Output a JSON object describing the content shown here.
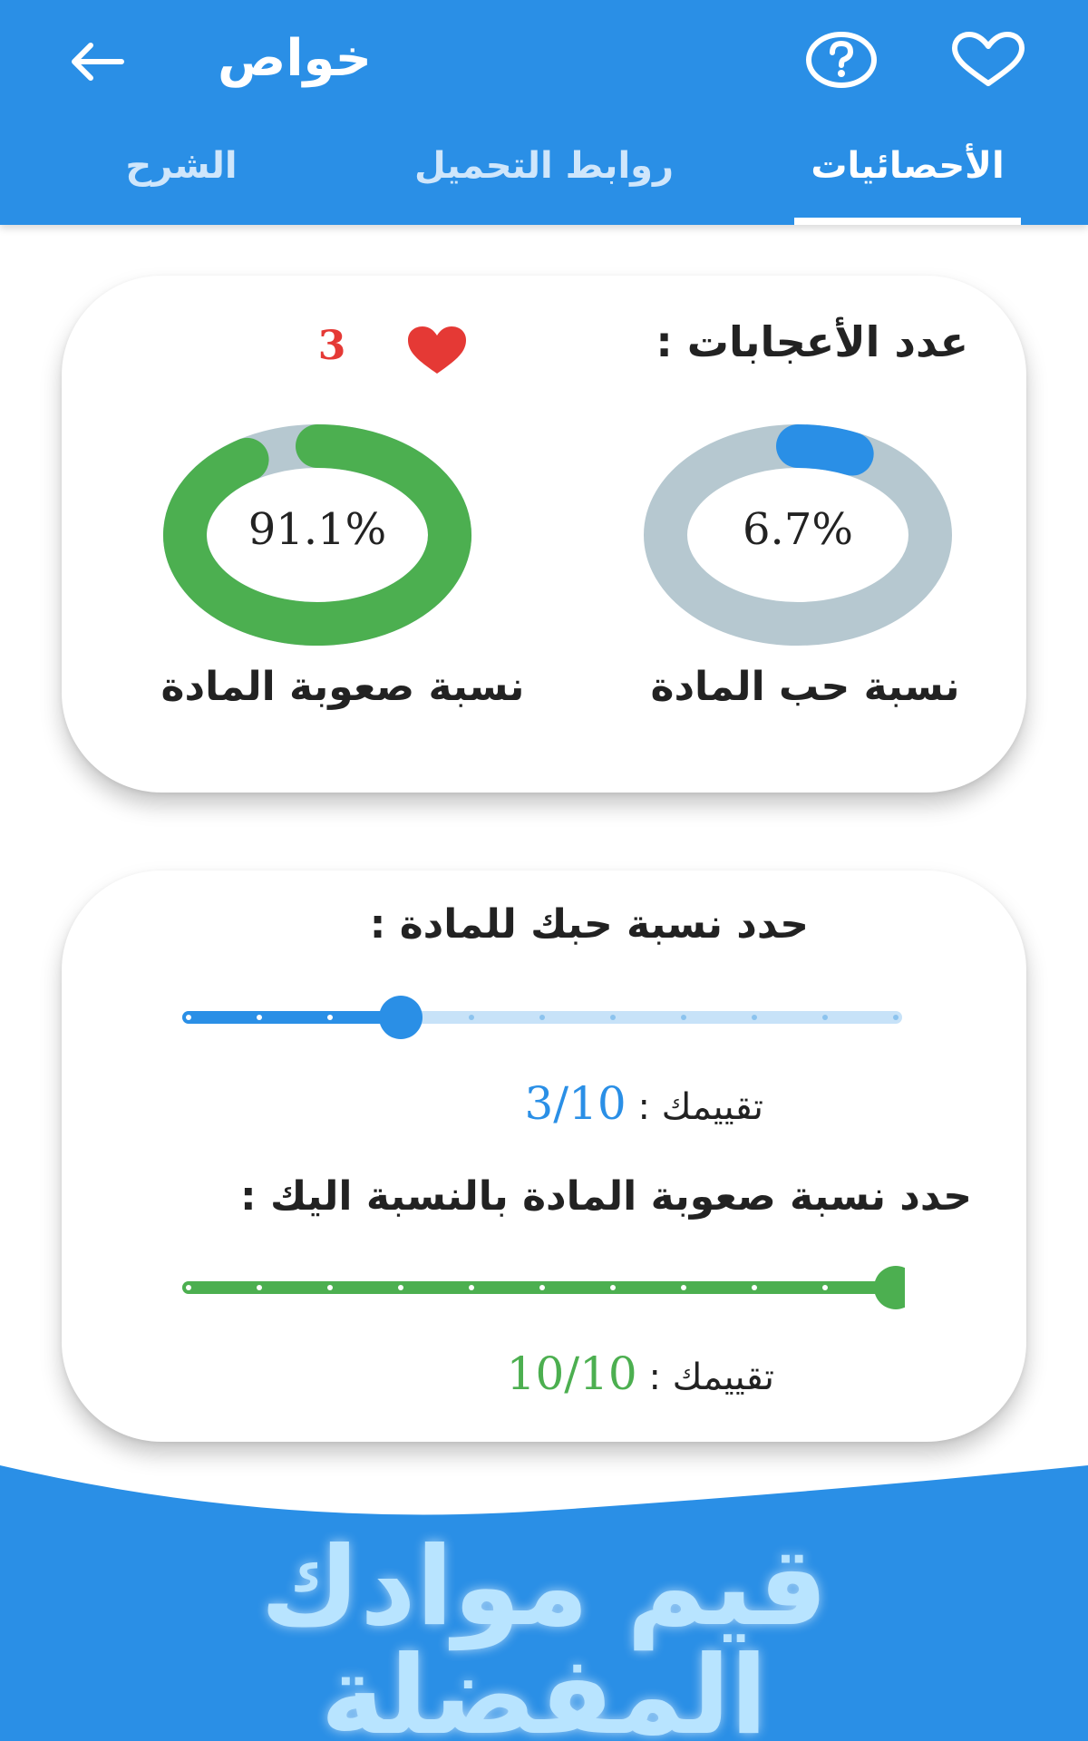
{
  "appbar": {
    "title": "خواص",
    "back_icon": "arrow-left-icon",
    "help_icon": "question-circle-icon",
    "favorite_icon": "heart-outline-icon",
    "color": "#2a8fe6"
  },
  "tabs": [
    {
      "label": "الأحصائيات",
      "active": true
    },
    {
      "label": "روابط التحميل",
      "active": false
    },
    {
      "label": "الشرح",
      "active": false
    }
  ],
  "stats": {
    "likes_label": "عدد الأعجابات :",
    "likes_count": "3",
    "love": {
      "value_text": "6.7%",
      "value": 6.7,
      "caption": "نسبة حب المادة",
      "color": "#2a8fe6",
      "track_color": "#b6c8d0"
    },
    "difficulty": {
      "value_text": "91.1%",
      "value": 91.1,
      "caption": "نسبة صعوبة المادة",
      "color": "#4caf50",
      "track_color": "#b6c8d0"
    }
  },
  "rating": {
    "love_question": "حدد نسبة حبك للمادة  :",
    "love_rating_label": "تقييمك :",
    "love_rating_value": "3/10",
    "love_level": 3,
    "difficulty_question": "حدد نسبة صعوبة المادة بالنسبة اليك  :",
    "difficulty_rating_label": "تقييمك :",
    "difficulty_rating_value": "10/10",
    "difficulty_level": 10,
    "max": 10
  },
  "banner": {
    "line1": "قيم موادك",
    "line2": "المفضلة",
    "color": "#2a8fe6"
  }
}
